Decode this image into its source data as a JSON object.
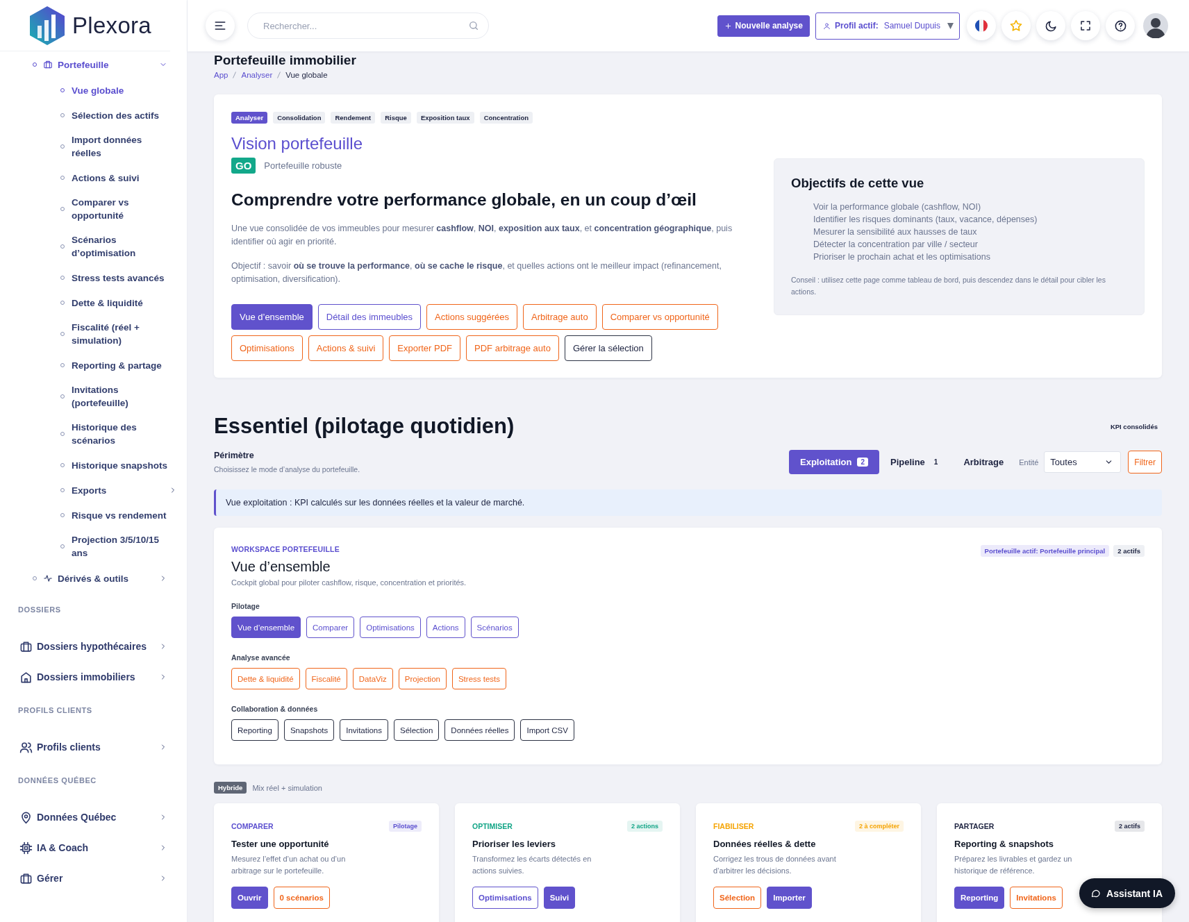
{
  "brand": {
    "name": "Plexora"
  },
  "sidebar": {
    "nav": [
      {
        "label": "Portefeuille",
        "selected": true,
        "expanded": true,
        "children": [
          {
            "label": "Vue globale",
            "selected": true
          },
          {
            "label": "Sélection des actifs",
            "selected": false
          },
          {
            "label": "Import données réelles",
            "selected": false
          },
          {
            "label": "Actions & suivi",
            "selected": false
          },
          {
            "label": "Comparer vs opportunité",
            "selected": false
          },
          {
            "label": "Scénarios d’optimisation",
            "selected": false
          },
          {
            "label": "Stress tests avancés",
            "selected": false
          },
          {
            "label": "Dette & liquidité",
            "selected": false
          },
          {
            "label": "Fiscalité (réel + simulation)",
            "selected": false
          },
          {
            "label": "Reporting & partage",
            "selected": false
          },
          {
            "label": "Invitations (portefeuille)",
            "selected": false
          },
          {
            "label": "Historique des scénarios",
            "selected": false
          },
          {
            "label": "Historique snapshots",
            "selected": false
          },
          {
            "label": "Exports",
            "selected": false,
            "expanded": false
          },
          {
            "label": "Risque vs rendement",
            "selected": false
          },
          {
            "label": "Projection 3/5/10/15 ans",
            "selected": false
          }
        ]
      },
      {
        "label": "Dérivés & outils",
        "selected": false,
        "expanded": false
      }
    ],
    "sections": [
      {
        "heading": "DOSSIERS",
        "items": [
          {
            "label": "Dossiers hypothécaires",
            "expanded": false
          },
          {
            "label": "Dossiers immobiliers",
            "expanded": false
          }
        ]
      },
      {
        "heading": "PROFILS CLIENTS",
        "items": [
          {
            "label": "Profils clients",
            "expanded": false
          }
        ]
      },
      {
        "heading": "DONNÉES QUÉBEC",
        "items": [
          {
            "label": "Données Québec",
            "expanded": false
          },
          {
            "label": "IA & Coach",
            "expanded": false
          },
          {
            "label": "Gérer",
            "expanded": false
          }
        ]
      }
    ]
  },
  "topbar": {
    "search": {
      "placeholder": "Rechercher..."
    },
    "new_button": "Nouvelle analyse",
    "profile": {
      "label": "Profil actif:",
      "name": "Samuel Dupuis"
    }
  },
  "page": {
    "title": "Portefeuille immobilier",
    "breadcrumb": [
      {
        "label": "App",
        "selected": false
      },
      {
        "label": "Analyser",
        "selected": false
      },
      {
        "label": "Vue globale",
        "selected": true
      }
    ]
  },
  "hero": {
    "tags": [
      {
        "label": "Analyser",
        "selected": true
      },
      {
        "label": "Consolidation",
        "selected": false
      },
      {
        "label": "Rendement",
        "selected": false
      },
      {
        "label": "Risque",
        "selected": false
      },
      {
        "label": "Exposition taux",
        "selected": false
      },
      {
        "label": "Concentration",
        "selected": false
      }
    ],
    "title": "Vision portefeuille",
    "status_badge": "GO",
    "status_text": "Portefeuille robuste",
    "headline": "Comprendre votre performance globale, en un coup d’œil",
    "paragraphs": [
      "Une vue consolidée de vos immeubles pour mesurer **cashflow**, **NOI**, **exposition aux taux**, et **concentration géographique**, puis identifier où agir en priorité.",
      "Objectif : savoir **où se trouve la performance**, **où se cache le risque**, et quelles actions ont le meilleur impact (refinancement, optimisation, diversification)."
    ],
    "button_rows": [
      [
        {
          "label": "Vue d’ensemble",
          "kind": "primary"
        },
        {
          "label": "Détail des immeubles",
          "kind": "outline"
        },
        {
          "label": "Actions suggérées",
          "kind": "warning"
        },
        {
          "label": "Arbitrage auto",
          "kind": "warning"
        },
        {
          "label": "Comparer vs opportunité",
          "kind": "warning"
        }
      ],
      [
        {
          "label": "Optimisations",
          "kind": "warning"
        },
        {
          "label": "Actions & suivi",
          "kind": "warning"
        },
        {
          "label": "Exporter PDF",
          "kind": "warning"
        },
        {
          "label": "PDF arbitrage auto",
          "kind": "warning"
        },
        {
          "label": "Gérer la sélection",
          "kind": "neutral"
        }
      ]
    ],
    "objectives": {
      "title": "Objectifs de cette vue",
      "items": [
        "Voir la performance globale (cashflow, NOI)",
        "Identifier les risques dominants (taux, vacance, dépenses)",
        "Mesurer la sensibilité aux hausses de taux",
        "Détecter la concentration par ville / secteur",
        "Prioriser le prochain achat et les optimisations"
      ],
      "tip": "Conseil : utilisez cette page comme tableau de bord, puis descendez dans le détail pour cibler les actions."
    }
  },
  "essentiel": {
    "title": "Essentiel (pilotage quotidien)",
    "note": "KPI consolidés",
    "perimetre": {
      "label": "Périmètre",
      "hint": "Choisissez le mode d’analyse du portefeuille."
    },
    "modes": [
      {
        "label": "Exploitation",
        "count": "2",
        "selected": true
      },
      {
        "label": "Pipeline",
        "count": "1",
        "selected": false
      },
      {
        "label": "Arbitrage",
        "selected": false
      }
    ],
    "entity": {
      "label": "Entité",
      "value": "Toutes"
    },
    "filter_button": "Filtrer",
    "alert": "Vue exploitation : KPI calculés sur les données réelles et la valeur de marché."
  },
  "workspace": {
    "eyebrow": "WORKSPACE PORTEFEUILLE",
    "title": "Vue d’ensemble",
    "subtitle": "Cockpit global pour piloter cashflow, risque, concentration et priorités.",
    "badges": [
      {
        "label": "Portefeuille actif: Portefeuille principal",
        "kind": "accent"
      },
      {
        "label": "2 actifs",
        "kind": "muted"
      }
    ],
    "groups": [
      {
        "heading": "Pilotage",
        "buttons": [
          {
            "label": "Vue d’ensemble",
            "kind": "primary"
          },
          {
            "label": "Comparer",
            "kind": "outline"
          },
          {
            "label": "Optimisations",
            "kind": "outline"
          },
          {
            "label": "Actions",
            "kind": "outline"
          },
          {
            "label": "Scénarios",
            "kind": "outline"
          }
        ]
      },
      {
        "heading": "Analyse avancée",
        "buttons": [
          {
            "label": "Dette & liquidité",
            "kind": "warning"
          },
          {
            "label": "Fiscalité",
            "kind": "warning"
          },
          {
            "label": "DataViz",
            "kind": "warning"
          },
          {
            "label": "Projection",
            "kind": "warning"
          },
          {
            "label": "Stress tests",
            "kind": "warning"
          }
        ]
      },
      {
        "heading": "Collaboration & données",
        "buttons": [
          {
            "label": "Reporting",
            "kind": "neutral"
          },
          {
            "label": "Snapshots",
            "kind": "neutral"
          },
          {
            "label": "Invitations",
            "kind": "neutral"
          },
          {
            "label": "Sélection",
            "kind": "neutral"
          },
          {
            "label": "Données réelles",
            "kind": "neutral"
          },
          {
            "label": "Import CSV",
            "kind": "neutral"
          }
        ]
      }
    ]
  },
  "mode_note": {
    "badge": "Hybride",
    "text": "Mix réel + simulation"
  },
  "cards": [
    {
      "eyebrow": "COMPARER",
      "color": "#5b4fcf",
      "badge": "Pilotage",
      "title": "Tester une opportunité",
      "text": "Mesurez l’effet d’un achat ou d’un arbitrage sur le portefeuille.",
      "buttons": [
        {
          "label": "Ouvrir",
          "kind": "primary"
        },
        {
          "label": "0 scénarios",
          "kind": "warning"
        }
      ]
    },
    {
      "eyebrow": "OPTIMISER",
      "color": "#12a586",
      "badge": "2 actions",
      "title": "Prioriser les leviers",
      "text": "Transformez les écarts détectés en actions suivies.",
      "buttons": [
        {
          "label": "Optimisations",
          "kind": "outline"
        },
        {
          "label": "Suivi",
          "kind": "primary"
        }
      ]
    },
    {
      "eyebrow": "FIABILISER",
      "color": "#f5a300",
      "badge": "2 à compléter",
      "title": "Données réelles & dette",
      "text": "Corrigez les trous de données avant d’arbitrer les décisions.",
      "buttons": [
        {
          "label": "Sélection",
          "kind": "warning"
        },
        {
          "label": "Importer",
          "kind": "primary"
        }
      ]
    },
    {
      "eyebrow": "PARTAGER",
      "color": "#1d2340",
      "badge": "2 actifs",
      "title": "Reporting & snapshots",
      "text": "Préparez les livrables et gardez un historique de référence.",
      "buttons": [
        {
          "label": "Reporting",
          "kind": "primary"
        },
        {
          "label": "Invitations",
          "kind": "warning"
        }
      ]
    }
  ],
  "assistant_button": "Assistant IA"
}
